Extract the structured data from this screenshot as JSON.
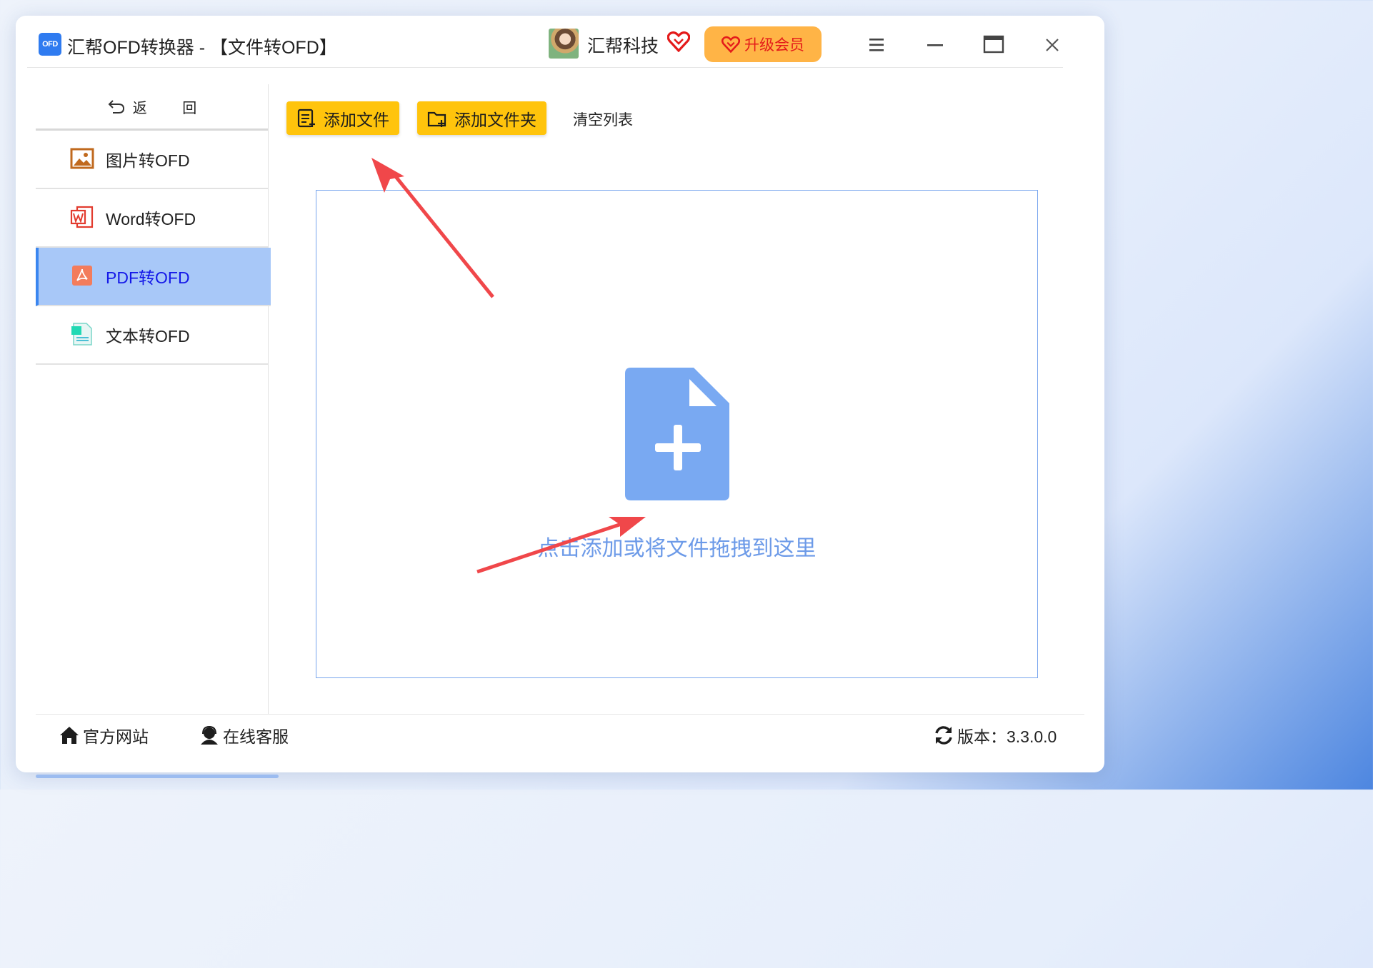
{
  "app": {
    "logo_text": "OFD",
    "title": "汇帮OFD转换器 - 【文件转OFD】"
  },
  "account": {
    "user_name": "汇帮科技",
    "upgrade_label": "升级会员",
    "vip_color": "#e41a1a",
    "upgrade_bg": "#ffb446"
  },
  "sidebar": {
    "back_label": "返 回",
    "items": [
      {
        "label": "图片转OFD",
        "icon": "image-icon"
      },
      {
        "label": "Word转OFD",
        "icon": "word-icon"
      },
      {
        "label": "PDF转OFD",
        "icon": "pdf-icon",
        "active": true
      },
      {
        "label": "文本转OFD",
        "icon": "text-file-icon"
      }
    ]
  },
  "toolbar": {
    "add_file_label": "添加文件",
    "add_folder_label": "添加文件夹",
    "clear_label": "清空列表",
    "button_color": "#ffc40c"
  },
  "dropzone": {
    "hint": "点击添加或将文件拖拽到这里",
    "icon": "file-add-icon",
    "accent": "#79a6ee"
  },
  "footer": {
    "website_label": "官方网站",
    "support_label": "在线客服",
    "version_label": "版本：3.3.0.0"
  },
  "annotations": {
    "arrow_color": "#f0474a"
  }
}
